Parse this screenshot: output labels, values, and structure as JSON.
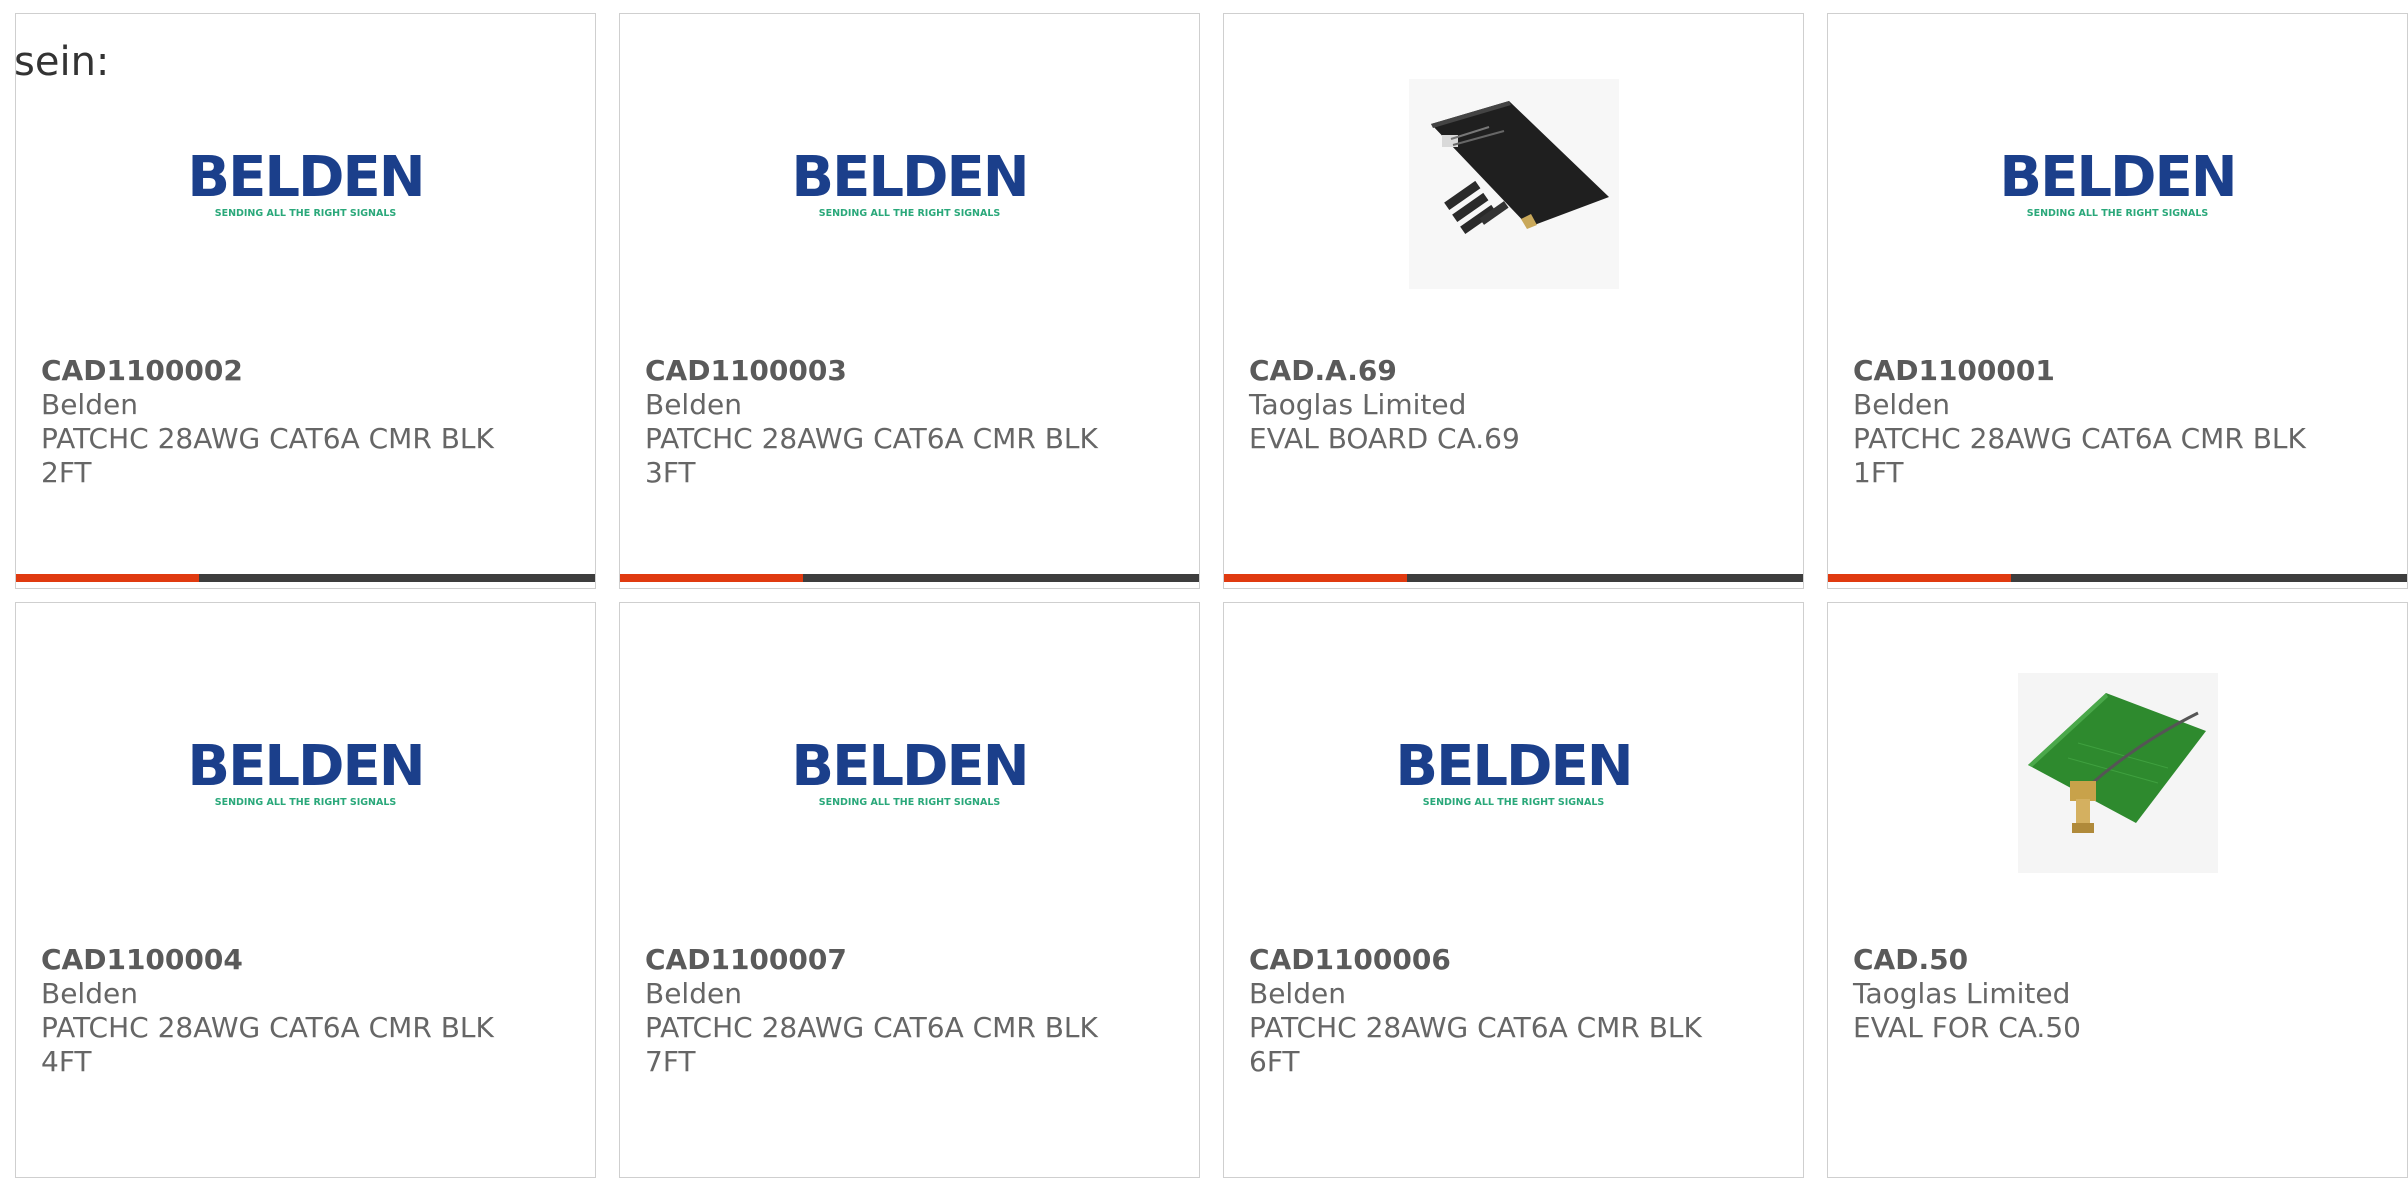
{
  "intro_text": "sein:",
  "colors": {
    "accent": "#e03a10",
    "bar": "#3d3d3d",
    "card_border": "#cfcfcf",
    "belden_blue": "#1b3f8b",
    "belden_green": "#2aa87a"
  },
  "products": [
    {
      "part_number": "CAD1100002",
      "manufacturer": "Belden",
      "desc_line1": "PATCHC 28AWG CAT6A CMR BLK",
      "desc_line2": "2FT",
      "image": "belden-logo",
      "logo_word": "BELDEN",
      "logo_tagline": "SENDING ALL THE RIGHT SIGNALS"
    },
    {
      "part_number": "CAD1100003",
      "manufacturer": "Belden",
      "desc_line1": "PATCHC 28AWG CAT6A CMR BLK",
      "desc_line2": "3FT",
      "image": "belden-logo",
      "logo_word": "BELDEN",
      "logo_tagline": "SENDING ALL THE RIGHT SIGNALS"
    },
    {
      "part_number": "CAD.A.69",
      "manufacturer": "Taoglas Limited",
      "desc_line1": "EVAL BOARD CA.69",
      "desc_line2": "",
      "image": "black-eval-board-photo"
    },
    {
      "part_number": "CAD1100001",
      "manufacturer": "Belden",
      "desc_line1": "PATCHC 28AWG CAT6A CMR BLK",
      "desc_line2": "1FT",
      "image": "belden-logo",
      "logo_word": "BELDEN",
      "logo_tagline": "SENDING ALL THE RIGHT SIGNALS"
    },
    {
      "part_number": "CAD1100004",
      "manufacturer": "Belden",
      "desc_line1": "PATCHC 28AWG CAT6A CMR BLK",
      "desc_line2": "4FT",
      "image": "belden-logo",
      "logo_word": "BELDEN",
      "logo_tagline": "SENDING ALL THE RIGHT SIGNALS"
    },
    {
      "part_number": "CAD1100007",
      "manufacturer": "Belden",
      "desc_line1": "PATCHC 28AWG CAT6A CMR BLK",
      "desc_line2": "7FT",
      "image": "belden-logo",
      "logo_word": "BELDEN",
      "logo_tagline": "SENDING ALL THE RIGHT SIGNALS"
    },
    {
      "part_number": "CAD1100006",
      "manufacturer": "Belden",
      "desc_line1": "PATCHC 28AWG CAT6A CMR BLK",
      "desc_line2": "6FT",
      "image": "belden-logo",
      "logo_word": "BELDEN",
      "logo_tagline": "SENDING ALL THE RIGHT SIGNALS"
    },
    {
      "part_number": "CAD.50",
      "manufacturer": "Taoglas Limited",
      "desc_line1": "EVAL FOR CA.50",
      "desc_line2": "",
      "image": "green-antenna-board-photo"
    }
  ]
}
